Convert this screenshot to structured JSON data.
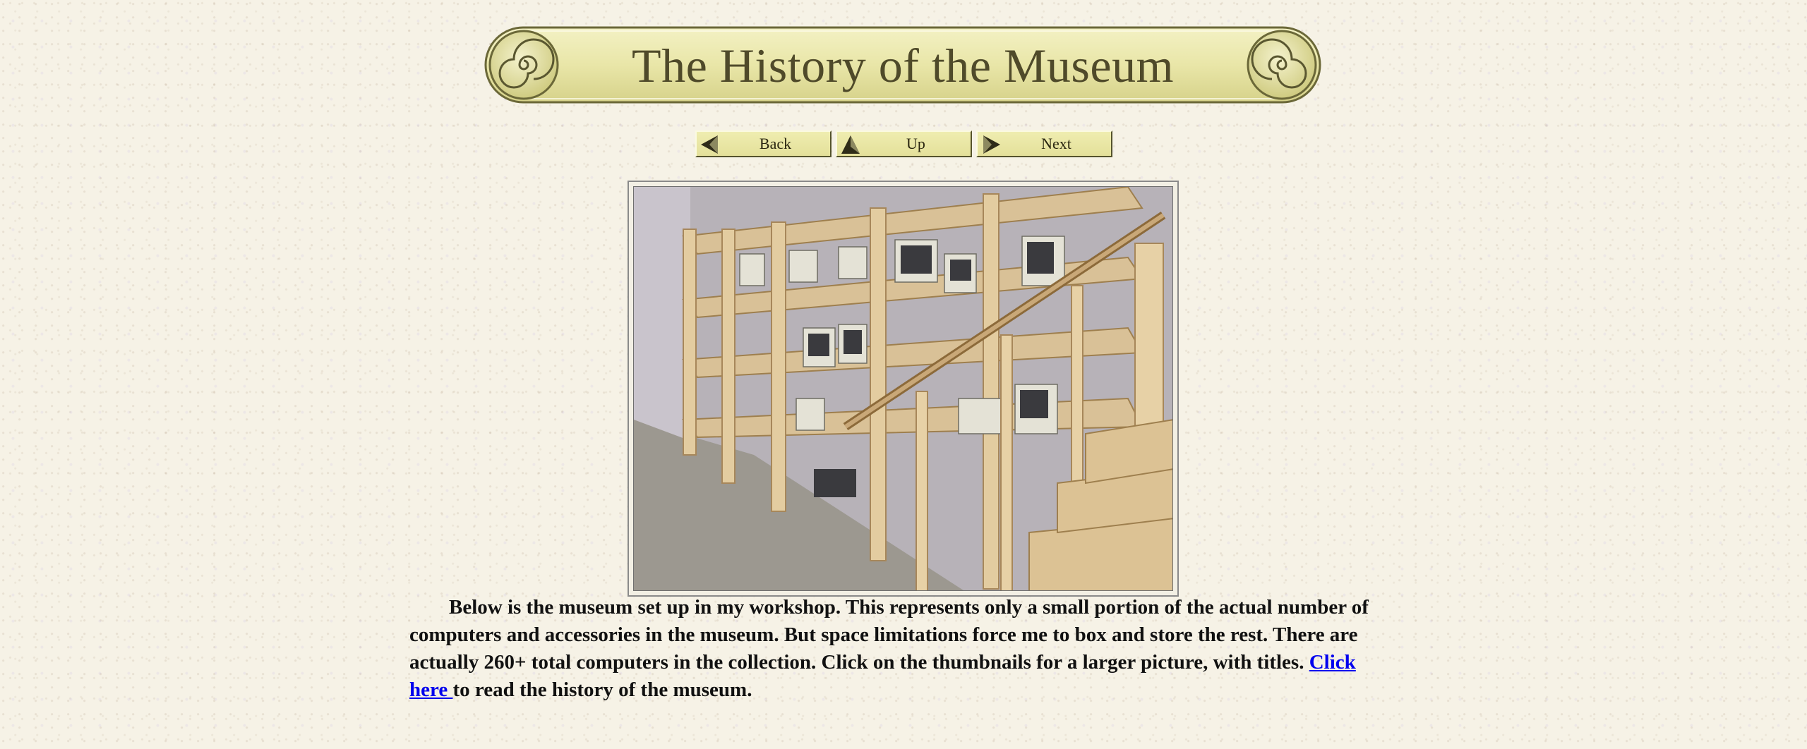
{
  "banner": {
    "title": "The History of the Museum"
  },
  "nav": {
    "back_label": "Back",
    "up_label": "Up",
    "next_label": "Next"
  },
  "photo": {
    "description": "museum-shelves-photo"
  },
  "paragraph": {
    "text_before_link": "Below is the museum set up in my workshop. This represents only a small portion of the actual number of  computers and accessories in the museum. But space limitations force me to box and store the rest. There are actually 260+ total computers in the collection.  Click on the thumbnails for a larger picture, with titles.  ",
    "link_text": "Click here ",
    "text_after_link": "to read the history of the museum."
  },
  "colors": {
    "background": "#f6f2e6",
    "banner_fill": "#e9e6a8",
    "link": "#0000ee"
  }
}
